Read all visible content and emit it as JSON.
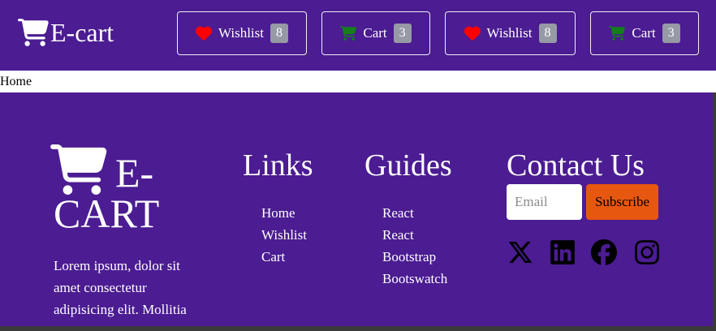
{
  "navbar": {
    "brand": "E-cart",
    "buttons": [
      {
        "label": "Wishlist",
        "count": "8",
        "icon": "heart-icon"
      },
      {
        "label": "Cart",
        "count": "3",
        "icon": "cart-icon"
      },
      {
        "label": "Wishlist",
        "count": "8",
        "icon": "heart-icon"
      },
      {
        "label": "Cart",
        "count": "3",
        "icon": "cart-icon"
      }
    ]
  },
  "breadcrumb": {
    "current": "Home"
  },
  "footer": {
    "logo_text": "E-CART",
    "description": "Lorem ipsum, dolor sit amet consectetur adipisicing elit. Mollitia",
    "links": {
      "title": "Links",
      "items": [
        "Home",
        "Wishlist",
        "Cart"
      ]
    },
    "guides": {
      "title": "Guides",
      "items": [
        "React",
        "React",
        "Bootstrap",
        "Bootswatch"
      ]
    },
    "contact": {
      "title": "Contact Us",
      "email_placeholder": "Email",
      "subscribe_label": "Subscribe",
      "social": [
        "x-icon",
        "linkedin-icon",
        "facebook-icon",
        "instagram-icon"
      ]
    }
  },
  "colors": {
    "background": "#4b1c92",
    "heart": "#ff0000",
    "cart_icon": "#137e1a",
    "badge": "#969aa5",
    "subscribe": "#e8570f"
  }
}
